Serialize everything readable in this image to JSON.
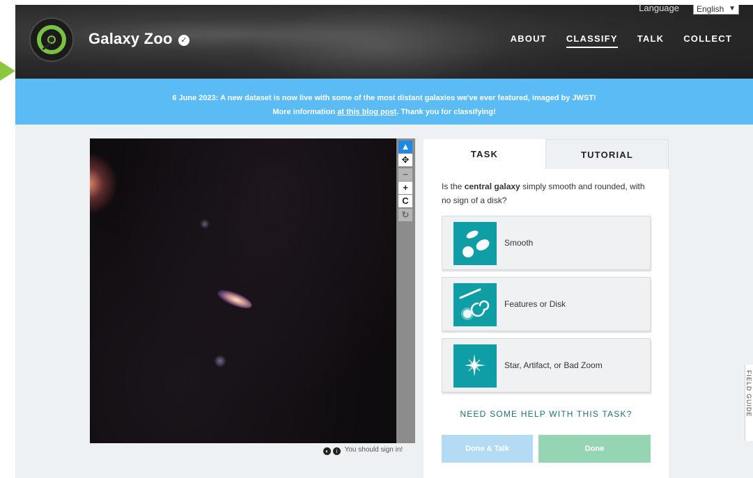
{
  "header": {
    "site_title": "Galaxy Zoo",
    "language_label": "Language",
    "language_value": "English",
    "nav": [
      "ABOUT",
      "CLASSIFY",
      "TALK",
      "COLLECT"
    ],
    "active_nav": "CLASSIFY"
  },
  "announcement": {
    "line1": "6 June 2023: A new dataset is now live with some of the most distant galaxies we've ever featured, imaged by JWST!",
    "line2_before": "More information ",
    "line2_link": "at this blog post",
    "line2_after": ". Thank you for classifying!"
  },
  "viewer": {
    "tools": [
      "▲",
      "✥",
      "−",
      "+",
      "C",
      "↻"
    ],
    "footer_text": "You should sign in!"
  },
  "task_panel": {
    "tabs": [
      "TASK",
      "TUTORIAL"
    ],
    "active_tab": "TASK",
    "question_before": "Is the ",
    "question_bold": "central galaxy",
    "question_after": " simply smooth and rounded, with no sign of a disk?",
    "answers": [
      {
        "label": "Smooth",
        "icon": "smooth-galaxies-icon"
      },
      {
        "label": "Features or Disk",
        "icon": "featured-galaxies-icon"
      },
      {
        "label": "Star, Artifact, or Bad Zoom",
        "icon": "star-artifact-icon"
      }
    ],
    "help_text": "NEED SOME HELP WITH THIS TASK?",
    "done_talk_label": "Done & Talk",
    "done_label": "Done"
  },
  "side_tab": {
    "label": "FIELD GUIDE"
  },
  "colors": {
    "announcement_bg": "#5bbcf5",
    "answer_icon_bg": "#0f9da6",
    "logo_green": "#7ac143",
    "done_button": "#95d5b4",
    "done_talk_button": "#b3dbf3",
    "active_tool": "#1e88e5"
  }
}
